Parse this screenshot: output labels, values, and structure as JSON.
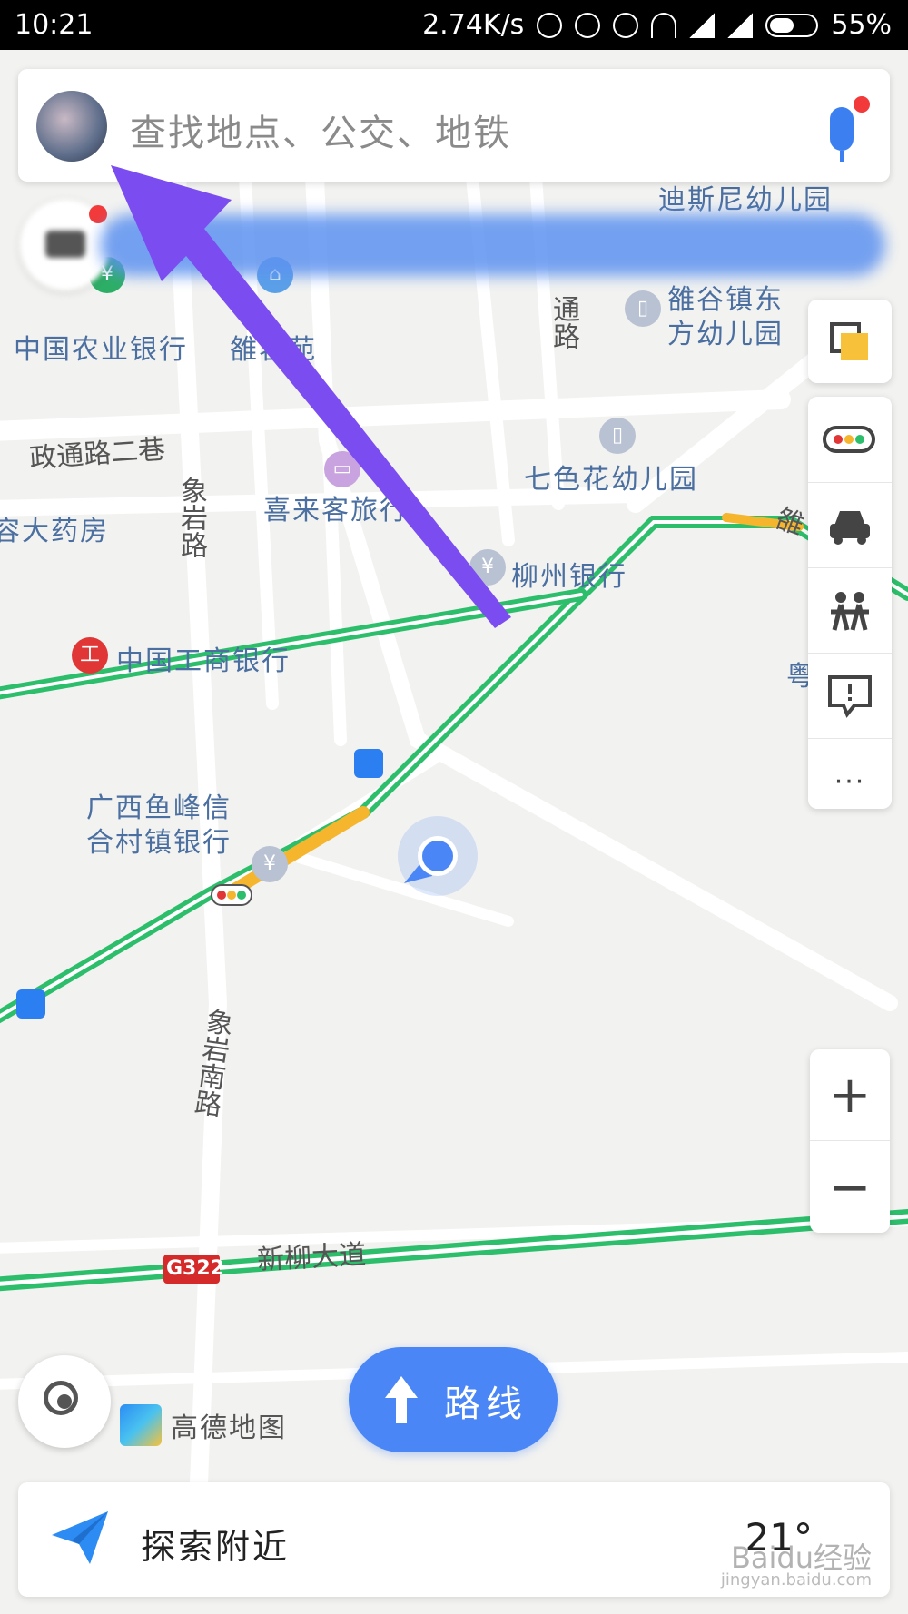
{
  "status_bar": {
    "time": "10:21",
    "network_speed": "2.74K/s",
    "battery": "55%",
    "battery_level": 0.55,
    "icons": [
      "hotspot-icon",
      "mute-icon",
      "alarm-icon",
      "wifi-icon",
      "signal-icon",
      "signal-icon",
      "battery-icon"
    ]
  },
  "search": {
    "placeholder": "查找地点、公交、地铁",
    "icons": [
      "avatar",
      "mic-icon"
    ]
  },
  "map": {
    "pois": [
      {
        "name": "中国农业银行"
      },
      {
        "name": "雒容苑"
      },
      {
        "name": "喜来客旅行"
      },
      {
        "name": "七色花幼儿园"
      },
      {
        "name": "柳州银行"
      },
      {
        "name": "中国工商银行"
      },
      {
        "name": "广西鱼峰信"
      },
      {
        "name": "合村镇银行"
      },
      {
        "name": "容大药房"
      },
      {
        "name": "雒谷镇东"
      },
      {
        "name": "方幼儿园"
      },
      {
        "name": "迪斯尼幼儿园"
      },
      {
        "name": "粤"
      }
    ],
    "roads": [
      "政通路二巷",
      "象岩路",
      "象岩南路",
      "新柳大道",
      "通路",
      "雒"
    ],
    "highway_badge": "G322"
  },
  "tools": {
    "layers": "layers-icon",
    "traffic": "traffic-light-icon",
    "taxi": "taxi-icon",
    "friends": "people-icon",
    "report": "report-icon",
    "more": "more-icon",
    "more_label": "···"
  },
  "zoom": {
    "in_label": "+",
    "out_label": "−"
  },
  "logo": {
    "text": "高德地图"
  },
  "route_button": {
    "label": "路线"
  },
  "explore": {
    "label": "探索附近",
    "temperature": "21°"
  },
  "watermark": {
    "text": "Baidu经验",
    "url": "jingyan.baidu.com"
  },
  "colors": {
    "accent": "#4a86f5",
    "traffic_green": "#2dbe6c",
    "traffic_yellow": "#f5b52c",
    "annotation": "#7b4cf0"
  }
}
